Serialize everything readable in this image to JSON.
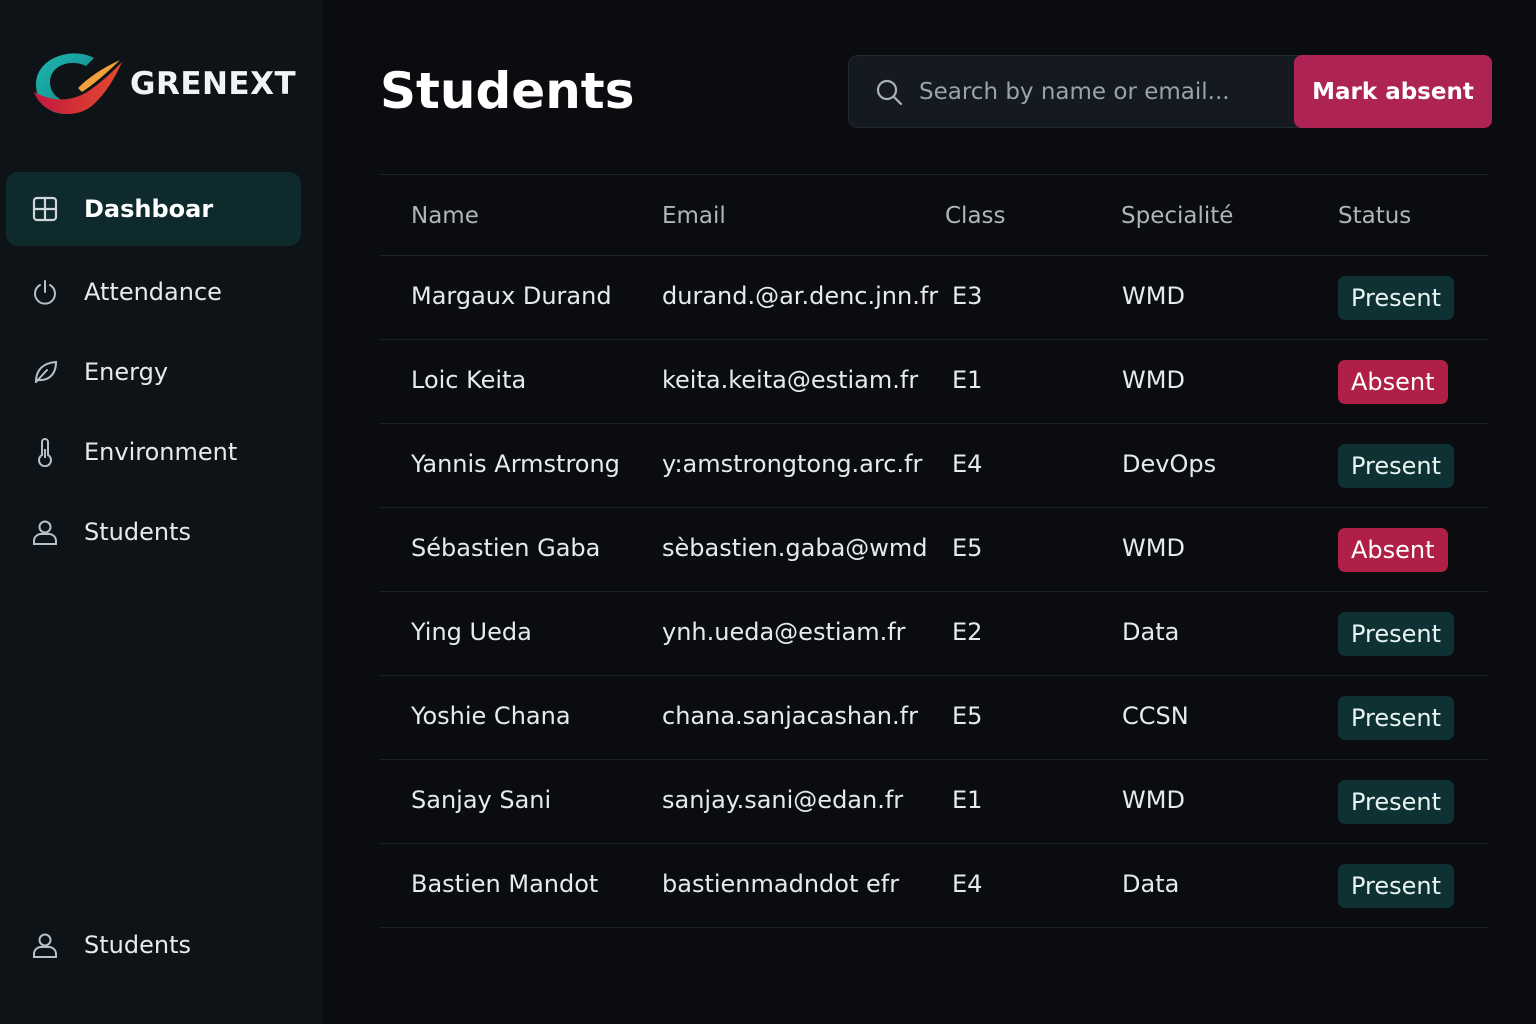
{
  "app": {
    "brand": "GRENEXT"
  },
  "sidebar": {
    "items": [
      {
        "label": "Dashboar",
        "icon": "grid-icon",
        "active": true
      },
      {
        "label": "Attendance",
        "icon": "power-icon",
        "active": false
      },
      {
        "label": "Energy",
        "icon": "leaf-icon",
        "active": false
      },
      {
        "label": "Environment",
        "icon": "thermometer-icon",
        "active": false
      },
      {
        "label": "Students",
        "icon": "user-icon",
        "active": false
      }
    ],
    "footer": {
      "label": "Students",
      "icon": "user-icon"
    }
  },
  "header": {
    "title": "Students",
    "search_placeholder": "Search by name or email...",
    "action_label": "Mark absent"
  },
  "table": {
    "columns": [
      "Name",
      "Email",
      "Class",
      "Specialité",
      "Status"
    ],
    "rows": [
      {
        "name": "Margaux Durand",
        "email": "durand.@ar.denc.jnn.fr",
        "class": "E3",
        "spec": "WMD",
        "status": "Present"
      },
      {
        "name": "Loic Keita",
        "email": "keita.keita@estiam.fr",
        "class": "E1",
        "spec": "WMD",
        "status": "Absent"
      },
      {
        "name": "Yannis Armstrong",
        "email": "y:amstrongtong.arc.fr",
        "class": "E4",
        "spec": "DevOps",
        "status": "Present"
      },
      {
        "name": "Sébastien Gaba",
        "email": "sèbastien.gaba@wmd",
        "class": "E5",
        "spec": "WMD",
        "status": "Absent"
      },
      {
        "name": "Ying Ueda",
        "email": "ynh.ueda@estiam.fr",
        "class": "E2",
        "spec": "Data",
        "status": "Present"
      },
      {
        "name": "Yoshie Chana",
        "email": "chana.sanjacashan.fr",
        "class": "E5",
        "spec": "CCSN",
        "status": "Present"
      },
      {
        "name": "Sanjay Sani",
        "email": "sanjay.sani@edan.fr",
        "class": "E1",
        "spec": "WMD",
        "status": "Present"
      },
      {
        "name": "Bastien Mandot",
        "email": "bastienmadndot efr",
        "class": "E4",
        "spec": "Data",
        "status": "Present"
      }
    ]
  },
  "colors": {
    "accent": "#ad2354",
    "present_bg": "#0e3234",
    "absent_bg": "#b01f45",
    "active_nav_bg": "#0e2a2c"
  }
}
